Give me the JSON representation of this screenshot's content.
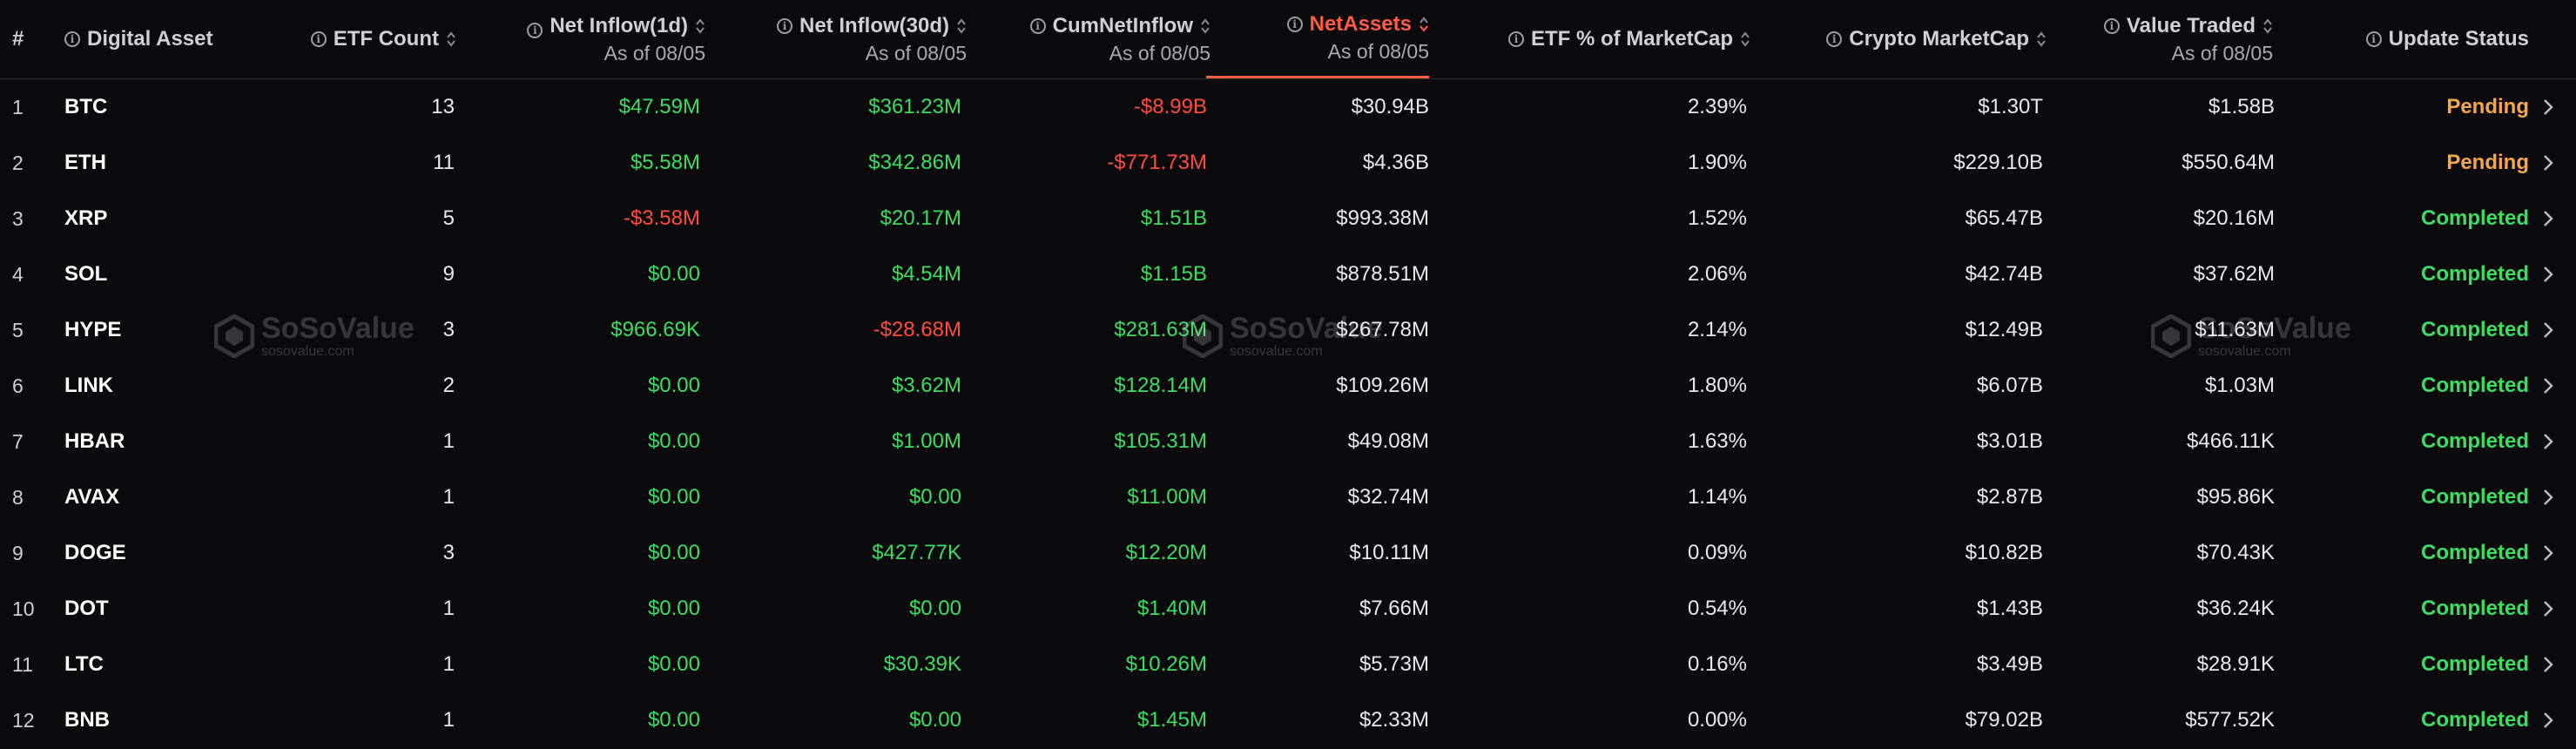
{
  "headers": {
    "rank": "#",
    "asset": "Digital Asset",
    "etf_count": "ETF Count",
    "net_inflow_1d": "Net Inflow(1d)",
    "net_inflow_1d_sub": "As of 08/05",
    "net_inflow_30d": "Net Inflow(30d)",
    "net_inflow_30d_sub": "As of 08/05",
    "cum_net_inflow": "CumNetInflow",
    "cum_net_inflow_sub": "As of 08/05",
    "net_assets": "NetAssets",
    "net_assets_sub": "As of 08/05",
    "etf_pct_marketcap": "ETF % of MarketCap",
    "crypto_marketcap": "Crypto MarketCap",
    "value_traded": "Value Traded",
    "value_traded_sub": "As of 08/05",
    "update_status": "Update Status"
  },
  "watermark": {
    "name": "SoSoValue",
    "url": "sosovalue.com"
  },
  "colors": {
    "positive": "#3ddc62",
    "negative": "#ff4c3d",
    "pending": "#f6a548",
    "active_sort": "#ff5b45",
    "background": "#0b0b0d"
  },
  "rows": [
    {
      "rank": "1",
      "asset": "BTC",
      "etf_count": "13",
      "net_inflow_1d": "$47.59M",
      "in1d_tone": "pos",
      "net_inflow_30d": "$361.23M",
      "in30d_tone": "pos",
      "cum_net_inflow": "-$8.99B",
      "cum_tone": "neg",
      "net_assets": "$30.94B",
      "etf_pct": "2.39%",
      "marketcap": "$1.30T",
      "value_traded": "$1.58B",
      "status": "Pending"
    },
    {
      "rank": "2",
      "asset": "ETH",
      "etf_count": "11",
      "net_inflow_1d": "$5.58M",
      "in1d_tone": "pos",
      "net_inflow_30d": "$342.86M",
      "in30d_tone": "pos",
      "cum_net_inflow": "-$771.73M",
      "cum_tone": "neg",
      "net_assets": "$4.36B",
      "etf_pct": "1.90%",
      "marketcap": "$229.10B",
      "value_traded": "$550.64M",
      "status": "Pending"
    },
    {
      "rank": "3",
      "asset": "XRP",
      "etf_count": "5",
      "net_inflow_1d": "-$3.58M",
      "in1d_tone": "neg",
      "net_inflow_30d": "$20.17M",
      "in30d_tone": "pos",
      "cum_net_inflow": "$1.51B",
      "cum_tone": "pos",
      "net_assets": "$993.38M",
      "etf_pct": "1.52%",
      "marketcap": "$65.47B",
      "value_traded": "$20.16M",
      "status": "Completed"
    },
    {
      "rank": "4",
      "asset": "SOL",
      "etf_count": "9",
      "net_inflow_1d": "$0.00",
      "in1d_tone": "pos",
      "net_inflow_30d": "$4.54M",
      "in30d_tone": "pos",
      "cum_net_inflow": "$1.15B",
      "cum_tone": "pos",
      "net_assets": "$878.51M",
      "etf_pct": "2.06%",
      "marketcap": "$42.74B",
      "value_traded": "$37.62M",
      "status": "Completed"
    },
    {
      "rank": "5",
      "asset": "HYPE",
      "etf_count": "3",
      "net_inflow_1d": "$966.69K",
      "in1d_tone": "pos",
      "net_inflow_30d": "-$28.68M",
      "in30d_tone": "neg",
      "cum_net_inflow": "$281.63M",
      "cum_tone": "pos",
      "net_assets": "$267.78M",
      "etf_pct": "2.14%",
      "marketcap": "$12.49B",
      "value_traded": "$11.63M",
      "status": "Completed"
    },
    {
      "rank": "6",
      "asset": "LINK",
      "etf_count": "2",
      "net_inflow_1d": "$0.00",
      "in1d_tone": "pos",
      "net_inflow_30d": "$3.62M",
      "in30d_tone": "pos",
      "cum_net_inflow": "$128.14M",
      "cum_tone": "pos",
      "net_assets": "$109.26M",
      "etf_pct": "1.80%",
      "marketcap": "$6.07B",
      "value_traded": "$1.03M",
      "status": "Completed"
    },
    {
      "rank": "7",
      "asset": "HBAR",
      "etf_count": "1",
      "net_inflow_1d": "$0.00",
      "in1d_tone": "pos",
      "net_inflow_30d": "$1.00M",
      "in30d_tone": "pos",
      "cum_net_inflow": "$105.31M",
      "cum_tone": "pos",
      "net_assets": "$49.08M",
      "etf_pct": "1.63%",
      "marketcap": "$3.01B",
      "value_traded": "$466.11K",
      "status": "Completed"
    },
    {
      "rank": "8",
      "asset": "AVAX",
      "etf_count": "1",
      "net_inflow_1d": "$0.00",
      "in1d_tone": "pos",
      "net_inflow_30d": "$0.00",
      "in30d_tone": "pos",
      "cum_net_inflow": "$11.00M",
      "cum_tone": "pos",
      "net_assets": "$32.74M",
      "etf_pct": "1.14%",
      "marketcap": "$2.87B",
      "value_traded": "$95.86K",
      "status": "Completed"
    },
    {
      "rank": "9",
      "asset": "DOGE",
      "etf_count": "3",
      "net_inflow_1d": "$0.00",
      "in1d_tone": "pos",
      "net_inflow_30d": "$427.77K",
      "in30d_tone": "pos",
      "cum_net_inflow": "$12.20M",
      "cum_tone": "pos",
      "net_assets": "$10.11M",
      "etf_pct": "0.09%",
      "marketcap": "$10.82B",
      "value_traded": "$70.43K",
      "status": "Completed"
    },
    {
      "rank": "10",
      "asset": "DOT",
      "etf_count": "1",
      "net_inflow_1d": "$0.00",
      "in1d_tone": "pos",
      "net_inflow_30d": "$0.00",
      "in30d_tone": "pos",
      "cum_net_inflow": "$1.40M",
      "cum_tone": "pos",
      "net_assets": "$7.66M",
      "etf_pct": "0.54%",
      "marketcap": "$1.43B",
      "value_traded": "$36.24K",
      "status": "Completed"
    },
    {
      "rank": "11",
      "asset": "LTC",
      "etf_count": "1",
      "net_inflow_1d": "$0.00",
      "in1d_tone": "pos",
      "net_inflow_30d": "$30.39K",
      "in30d_tone": "pos",
      "cum_net_inflow": "$10.26M",
      "cum_tone": "pos",
      "net_assets": "$5.73M",
      "etf_pct": "0.16%",
      "marketcap": "$3.49B",
      "value_traded": "$28.91K",
      "status": "Completed"
    },
    {
      "rank": "12",
      "asset": "BNB",
      "etf_count": "1",
      "net_inflow_1d": "$0.00",
      "in1d_tone": "pos",
      "net_inflow_30d": "$0.00",
      "in30d_tone": "pos",
      "cum_net_inflow": "$1.45M",
      "cum_tone": "pos",
      "net_assets": "$2.33M",
      "etf_pct": "0.00%",
      "marketcap": "$79.02B",
      "value_traded": "$577.52K",
      "status": "Completed"
    }
  ]
}
